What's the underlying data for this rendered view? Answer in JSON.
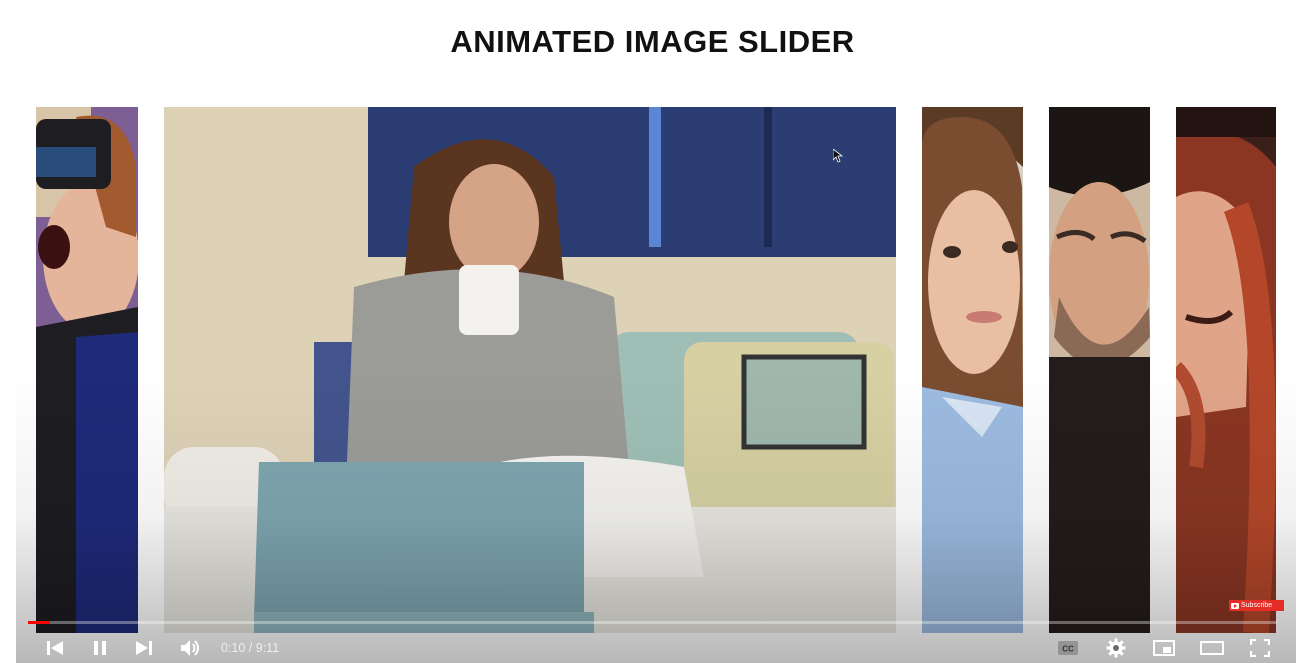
{
  "page": {
    "title": "ANIMATED IMAGE SLIDER"
  },
  "slides": [
    {
      "name": "man-with-vr-headset",
      "active": false
    },
    {
      "name": "woman-with-coffee-and-laptop",
      "active": true
    },
    {
      "name": "woman-portrait-blue-shirt",
      "active": false
    },
    {
      "name": "man-with-hat-winking",
      "active": false
    },
    {
      "name": "red-haired-woman",
      "active": false
    }
  ],
  "player": {
    "time_display": "0:10 / 9:11",
    "current_time": "0:10",
    "duration": "9:11",
    "progress_fraction": 0.018,
    "accent_color": "#ff0000",
    "subscribe_label": "Subscribe",
    "icons": [
      "previous-icon",
      "pause-icon",
      "next-icon",
      "volume-icon",
      "captions-icon",
      "settings-icon",
      "miniplayer-icon",
      "theater-mode-icon",
      "fullscreen-icon"
    ]
  }
}
